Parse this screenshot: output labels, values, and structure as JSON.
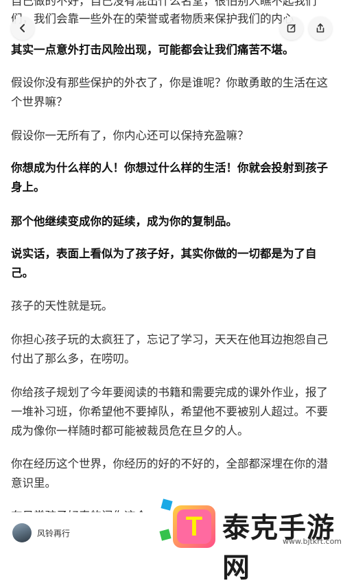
{
  "header": {
    "back_label": "‹",
    "clipped_line_1": "自己做的不好，自己没有混出什么名堂，很怕别人瞧不起我们",
    "clipped_line_2": "们，我们会靠一些外在的荣誉或者物质来保护我们的内心"
  },
  "paragraphs": [
    {
      "text": "其实一点意外打击风险出现，可能都会让我们痛苦不堪。",
      "bold": true
    },
    {
      "text": "假设你没有那些保护的外衣了，你是谁呢？你敢勇敢的生活在这个世界嘛？",
      "bold": false
    },
    {
      "text": "假设你一无所有了，你内心还可以保持充盈嘛？",
      "bold": false
    },
    {
      "text": "你想成为什么样的人！你想过什么样的生活！你就会投射到孩子身上。",
      "bold": true
    },
    {
      "text": "那个他继续变成你的延续，成为你的复制品。",
      "bold": true
    },
    {
      "text": "说实话，表面上看似为了孩子好，其实你做的一切都是为了自己。",
      "bold": true
    },
    {
      "text": "孩子的天性就是玩。",
      "bold": false
    },
    {
      "text": "你担心孩子玩的太疯狂了，忘记了学习，天天在他耳边抱怨自己付出了那么多，在唠叨。",
      "bold": false
    },
    {
      "text": "你给孩子规划了今年要阅读的书籍和需要完成的课外作业，报了一堆补习班，你希望他不要掉队，希望他不要被别人超过。不要成为像你一样随时都可能被裁员危在旦夕的人。",
      "bold": false
    },
    {
      "text": "你在经历这个世界，你经历的好的不好的，全部都深埋在你的潜意识里。",
      "bold": false
    },
    {
      "text": "在日常孩子好奇的问你这个",
      "bold": false
    }
  ],
  "footer": {
    "author_name": "风铃再行"
  },
  "watermark": {
    "badge_char": "T",
    "brand": "泰克手游网",
    "url": "www.bjtkrt.com"
  },
  "colors": {
    "text": "#333333",
    "bold_text": "#111111",
    "watermark_badge": "#ff4e8a",
    "watermark_badge_2": "#ffd23f"
  }
}
